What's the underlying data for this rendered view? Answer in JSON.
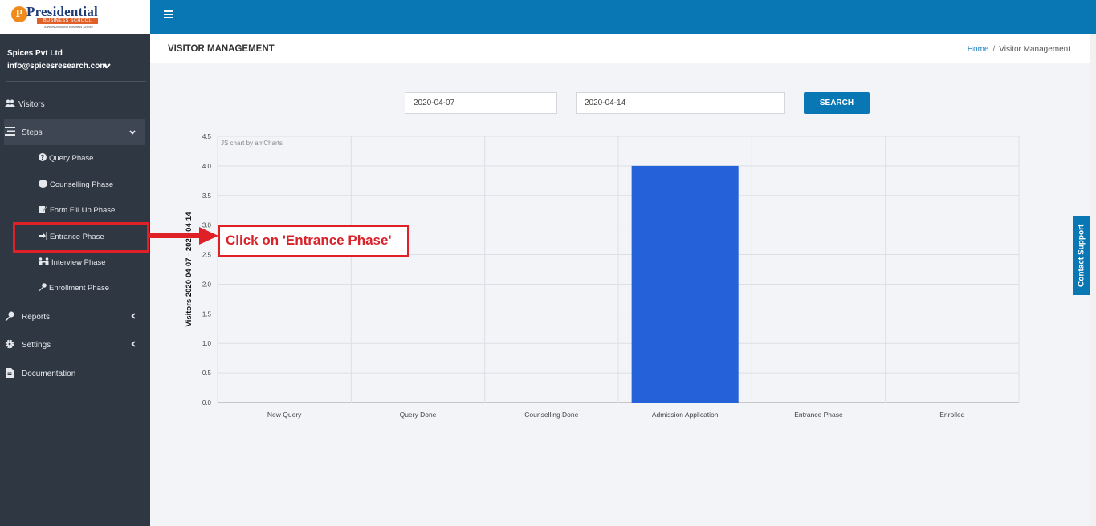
{
  "brand": {
    "logo_letter": "P",
    "name": "Presidential",
    "sub": "BUSINESS SCHOOL",
    "tagline": "A Wells Ambition Business School"
  },
  "profile": {
    "company": "Spices Pvt Ltd",
    "email": "info@spicesresearch.com"
  },
  "sidebar": {
    "items": [
      {
        "label": "Visitors",
        "icon": "users-icon"
      },
      {
        "label": "Steps",
        "icon": "list-icon"
      },
      {
        "label": "Reports",
        "icon": "key-icon"
      },
      {
        "label": "Settings",
        "icon": "gear-icon"
      },
      {
        "label": "Documentation",
        "icon": "document-icon"
      }
    ],
    "steps_sub": [
      {
        "label": "Query Phase",
        "icon": "question-circle-icon"
      },
      {
        "label": "Counselling Phase",
        "icon": "brain-icon"
      },
      {
        "label": "Form Fill Up Phase",
        "icon": "form-edit-icon"
      },
      {
        "label": "Entrance Phase",
        "icon": "sign-in-icon"
      },
      {
        "label": "Interview Phase",
        "icon": "interview-icon"
      },
      {
        "label": "Enrollment Phase",
        "icon": "key-icon"
      }
    ]
  },
  "header": {
    "page_title": "VISITOR MANAGEMENT",
    "breadcrumb_home": "Home",
    "breadcrumb_sep": "/",
    "breadcrumb_current": "Visitor Management"
  },
  "filters": {
    "from_date": "2020-04-07",
    "to_date": "2020-04-14",
    "search_label": "SEARCH"
  },
  "contact_support": "Contact Support",
  "annotation": {
    "text": "Click on 'Entrance Phase'"
  },
  "colors": {
    "topbar": "#0a77b5",
    "sidebar": "#2f3743",
    "bar": "#2561d9",
    "annotation": "#e02027"
  },
  "chart_data": {
    "type": "bar",
    "credit": "JS chart by amCharts",
    "ylabel": "Visitors 2020-04-07 - 2020-04-14",
    "categories": [
      "New Query",
      "Query Done",
      "Counselling Done",
      "Admission Application",
      "Entrance Phase",
      "Enrolled"
    ],
    "values": [
      0,
      0,
      0,
      4,
      0,
      0
    ],
    "ylim": [
      0,
      4.5
    ],
    "yticks": [
      "0.0",
      "0.5",
      "1.0",
      "1.5",
      "2.0",
      "2.5",
      "3.0",
      "3.5",
      "4.0",
      "4.5"
    ],
    "grid": true
  }
}
